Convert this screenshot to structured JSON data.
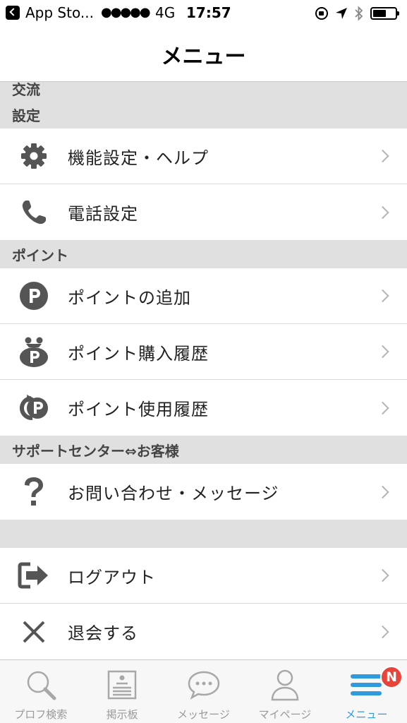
{
  "status_bar": {
    "app": "App Sto...",
    "signal": "●●●●●",
    "network": "4G",
    "time": "17:57"
  },
  "nav": {
    "title": "メニュー"
  },
  "sections": {
    "clipped_header": "交流",
    "settings": {
      "header": "設定",
      "items": [
        {
          "label": "機能設定・ヘルプ",
          "icon": "gear-icon"
        },
        {
          "label": "電話設定",
          "icon": "phone-icon"
        }
      ]
    },
    "points": {
      "header": "ポイント",
      "items": [
        {
          "label": "ポイントの追加",
          "icon": "point-circle-icon"
        },
        {
          "label": "ポイント購入履歴",
          "icon": "point-purse-icon"
        },
        {
          "label": "ポイント使用履歴",
          "icon": "point-refresh-icon"
        }
      ]
    },
    "support": {
      "header": "サポートセンター⇔お客様",
      "items": [
        {
          "label": "お問い合わせ・メッセージ",
          "icon": "question-icon"
        }
      ]
    },
    "account": {
      "items": [
        {
          "label": "ログアウト",
          "icon": "logout-icon"
        },
        {
          "label": "退会する",
          "icon": "close-icon"
        }
      ]
    }
  },
  "tab_bar": {
    "tabs": [
      {
        "label": "プロフ検索",
        "icon": "search-icon"
      },
      {
        "label": "掲示板",
        "icon": "board-icon"
      },
      {
        "label": "メッセージ",
        "icon": "chat-icon"
      },
      {
        "label": "マイページ",
        "icon": "person-icon"
      },
      {
        "label": "メニュー",
        "icon": "menu-icon",
        "badge": "N",
        "active": true
      }
    ]
  },
  "colors": {
    "accent": "#2f9bdc",
    "badge": "#e8443a",
    "icon": "#555555",
    "section_bg": "#e0e0e0"
  }
}
